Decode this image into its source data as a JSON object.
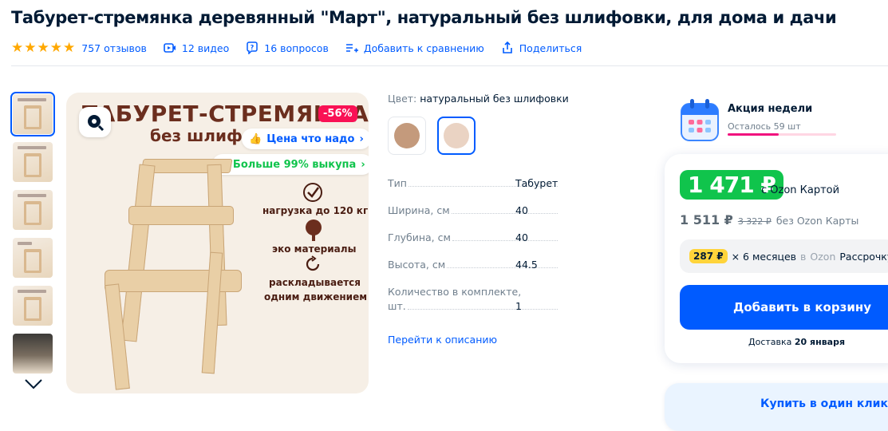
{
  "product": {
    "title": "Табурет-стремянка деревянный \"Март\", натуральный без шлифовки, для дома и дачи",
    "rating_stars": 5,
    "reviews": "757 отзывов",
    "videos": "12 видео",
    "questions": "16 вопросов",
    "compare": "Добавить к сравнению",
    "share": "Поделиться"
  },
  "gallery": {
    "hero_title": "ТАБУРЕТ-СТРЕМЯНКА",
    "hero_subtitle": "без шлифовки",
    "discount": "-56%",
    "price_pill": "Цена что надо",
    "buyout_pill": "Больше 99% выкупа",
    "features": [
      "нагрузка до 120 кг",
      "эко материалы",
      "раскладывается",
      "одним движением"
    ]
  },
  "characteristics": {
    "color_label": "Цвет:",
    "color_value": "натуральный без шлифовки",
    "swatch_colors": [
      "#c49a7c",
      "#ead3c3"
    ],
    "rows": [
      {
        "label": "Тип",
        "value": "Табурет"
      },
      {
        "label": "Ширина, см",
        "value": "40"
      },
      {
        "label": "Глубина, см",
        "value": "40"
      },
      {
        "label": "Высота, см",
        "value": "44.5"
      },
      {
        "label": "Количество в комплекте,",
        "label2": "шт.",
        "value": "1"
      }
    ],
    "go_to_description": "Перейти к описанию"
  },
  "promo": {
    "title": "Акция недели",
    "remaining": "Осталось 59 шт",
    "remaining_fraction": 0.47
  },
  "buy": {
    "price_card": "1 471 ₽",
    "with_card": "с Ozon Картой",
    "price_regular": "1 511 ₽",
    "price_old": "3 322 ₽",
    "without_card": "без Ozon Карты",
    "installment_amount": "287 ₽",
    "installment_months": "× 6 месяцев",
    "installment_in": "в",
    "installment_brand": "Ozon",
    "installment_word": "Рассрочку",
    "add_to_cart": "Добавить в корзину",
    "delivery_label": "Доставка",
    "delivery_date": "20 января",
    "one_click": "Купить в один клик"
  },
  "colors": {
    "accent": "#005bff",
    "green": "#10c44c",
    "pink": "#f91155",
    "star": "#ffa800"
  }
}
